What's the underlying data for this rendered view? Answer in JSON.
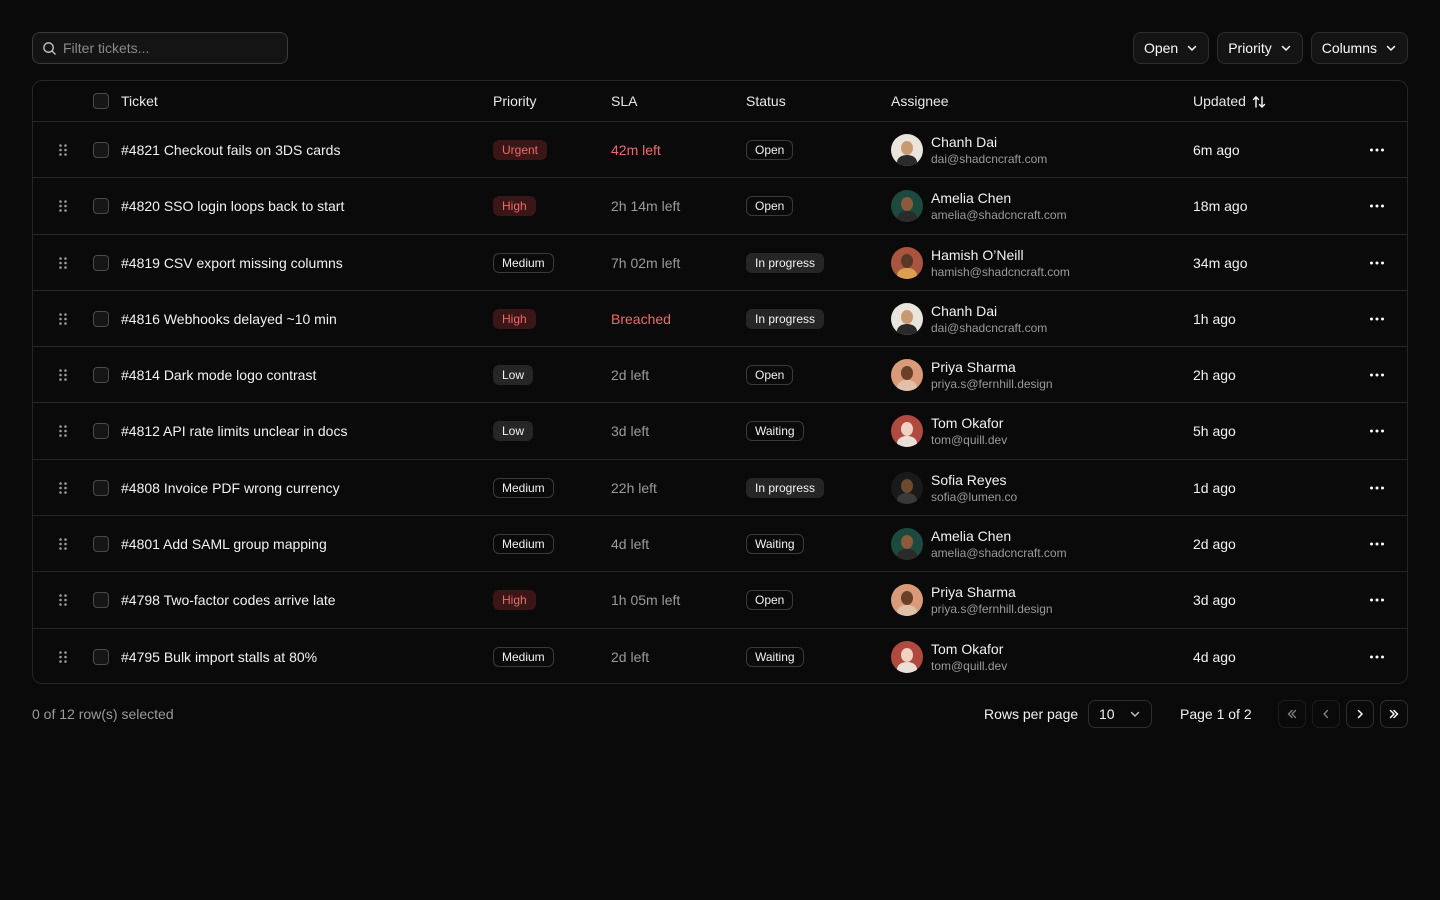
{
  "search": {
    "placeholder": "Filter tickets..."
  },
  "filters": [
    {
      "label": "Open"
    },
    {
      "label": "Priority"
    },
    {
      "label": "Columns"
    }
  ],
  "columns": {
    "ticket": "Ticket",
    "priority": "Priority",
    "sla": "SLA",
    "status": "Status",
    "assignee": "Assignee",
    "updated": "Updated"
  },
  "rows": [
    {
      "ticket": "#4821 Checkout fails on 3DS cards",
      "priority": "Urgent",
      "priority_style": "red",
      "sla": "42m left",
      "sla_style": "danger",
      "status": "Open",
      "status_style": "outline",
      "name": "Chanh Dai",
      "email": "dai@shadcncraft.com",
      "avatar_bg": "#e9e4dc",
      "skin": "#c89a72",
      "shirt": "#2a2a2a",
      "updated": "6m ago"
    },
    {
      "ticket": "#4820 SSO login loops back to start",
      "priority": "High",
      "priority_style": "red",
      "sla": "2h 14m left",
      "sla_style": "",
      "status": "Open",
      "status_style": "outline",
      "name": "Amelia Chen",
      "email": "amelia@shadcncraft.com",
      "avatar_bg": "#1c4a3e",
      "skin": "#8a5a3c",
      "shirt": "#2b2b2b",
      "updated": "18m ago"
    },
    {
      "ticket": "#4819 CSV export missing columns",
      "priority": "Medium",
      "priority_style": "outline",
      "sla": "7h 02m left",
      "sla_style": "",
      "status": "In progress",
      "status_style": "gray",
      "name": "Hamish O’Neill",
      "email": "hamish@shadcncraft.com",
      "avatar_bg": "#a8543e",
      "skin": "#5a3826",
      "shirt": "#d9a050",
      "updated": "34m ago"
    },
    {
      "ticket": "#4816 Webhooks delayed ~10 min",
      "priority": "High",
      "priority_style": "red",
      "sla": "Breached",
      "sla_style": "danger",
      "status": "In progress",
      "status_style": "gray",
      "name": "Chanh Dai",
      "email": "dai@shadcncraft.com",
      "avatar_bg": "#e9e4dc",
      "skin": "#c89a72",
      "shirt": "#2a2a2a",
      "updated": "1h ago"
    },
    {
      "ticket": "#4814 Dark mode logo contrast",
      "priority": "Low",
      "priority_style": "gray",
      "sla": "2d left",
      "sla_style": "",
      "status": "Open",
      "status_style": "outline",
      "name": "Priya Sharma",
      "email": "priya.s@fernhill.design",
      "avatar_bg": "#d89a78",
      "skin": "#6a4028",
      "shirt": "#e0c0a8",
      "updated": "2h ago"
    },
    {
      "ticket": "#4812 API rate limits unclear in docs",
      "priority": "Low",
      "priority_style": "gray",
      "sla": "3d left",
      "sla_style": "",
      "status": "Waiting",
      "status_style": "outline",
      "name": "Tom Okafor",
      "email": "tom@quill.dev",
      "avatar_bg": "#b04a40",
      "skin": "#f0d2c0",
      "shirt": "#e8e0d8",
      "updated": "5h ago"
    },
    {
      "ticket": "#4808 Invoice PDF wrong currency",
      "priority": "Medium",
      "priority_style": "outline",
      "sla": "22h left",
      "sla_style": "",
      "status": "In progress",
      "status_style": "gray",
      "name": "Sofia Reyes",
      "email": "sofia@lumen.co",
      "avatar_bg": "#1a1a1a",
      "skin": "#6a4a30",
      "shirt": "#3a3a3a",
      "updated": "1d ago"
    },
    {
      "ticket": "#4801 Add SAML group mapping",
      "priority": "Medium",
      "priority_style": "outline",
      "sla": "4d left",
      "sla_style": "",
      "status": "Waiting",
      "status_style": "outline",
      "name": "Amelia Chen",
      "email": "amelia@shadcncraft.com",
      "avatar_bg": "#1c4a3e",
      "skin": "#8a5a3c",
      "shirt": "#2b2b2b",
      "updated": "2d ago"
    },
    {
      "ticket": "#4798 Two-factor codes arrive late",
      "priority": "High",
      "priority_style": "red",
      "sla": "1h 05m left",
      "sla_style": "",
      "status": "Open",
      "status_style": "outline",
      "name": "Priya Sharma",
      "email": "priya.s@fernhill.design",
      "avatar_bg": "#d89a78",
      "skin": "#6a4028",
      "shirt": "#e0c0a8",
      "updated": "3d ago"
    },
    {
      "ticket": "#4795 Bulk import stalls at 80%",
      "priority": "Medium",
      "priority_style": "outline",
      "sla": "2d left",
      "sla_style": "",
      "status": "Waiting",
      "status_style": "outline",
      "name": "Tom Okafor",
      "email": "tom@quill.dev",
      "avatar_bg": "#b04a40",
      "skin": "#f0d2c0",
      "shirt": "#e8e0d8",
      "updated": "4d ago"
    }
  ],
  "footer": {
    "selected_text": "0 of 12 row(s) selected",
    "rows_per_page_label": "Rows per page",
    "rows_per_page_value": "10",
    "page_text": "Page 1 of 2"
  }
}
